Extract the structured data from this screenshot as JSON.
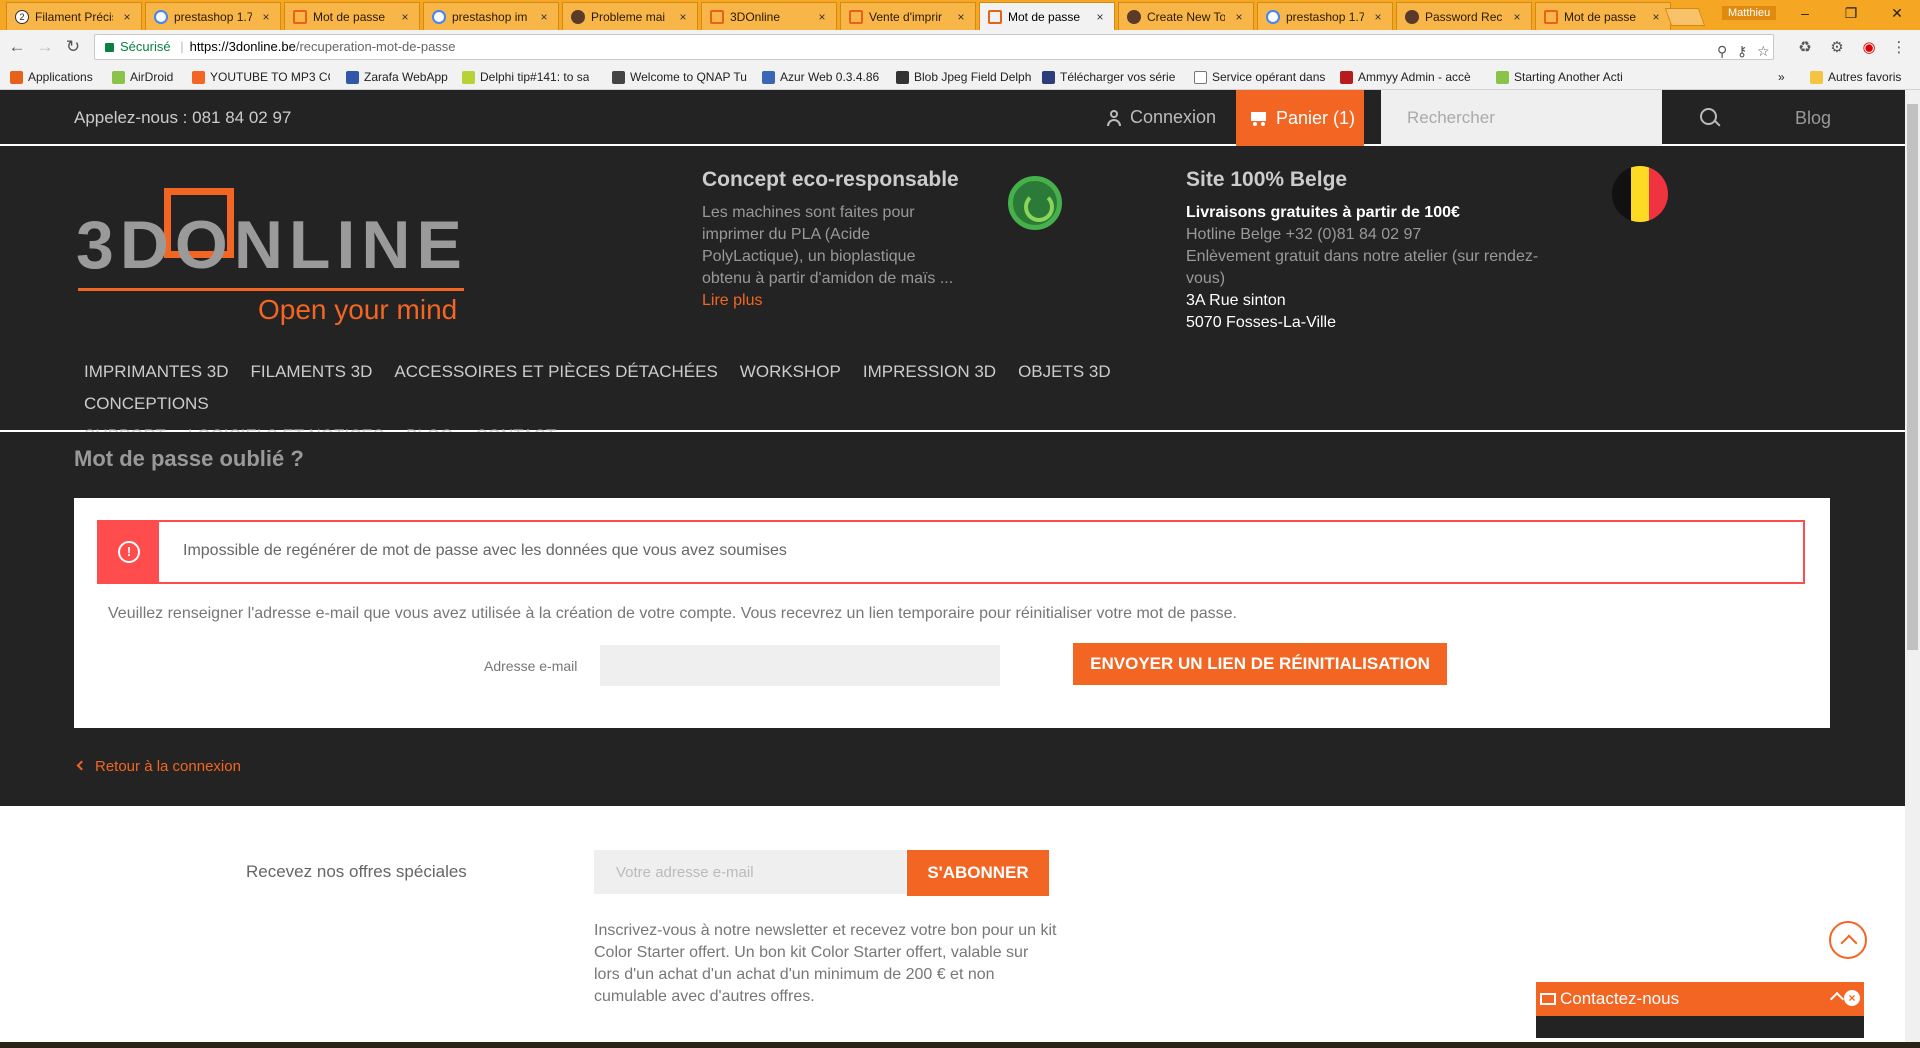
{
  "browser": {
    "tabs": [
      {
        "title": "Filament Précis",
        "icon": "num",
        "left": 0
      },
      {
        "title": "prestashop 1.7",
        "icon": "g",
        "left": 0
      },
      {
        "title": "Mot de passe",
        "icon": "orange",
        "left": 0
      },
      {
        "title": "prestashop im",
        "icon": "g",
        "left": 0
      },
      {
        "title": "Probleme mai",
        "icon": "ps",
        "left": 0
      },
      {
        "title": "3DOnline",
        "icon": "orange",
        "left": 0
      },
      {
        "title": "Vente d'imprir",
        "icon": "orange",
        "left": 0
      },
      {
        "title": "Mot de passe",
        "icon": "orange",
        "left": 0
      },
      {
        "title": "Create New To",
        "icon": "ps",
        "left": 0
      },
      {
        "title": "prestashop 1.7",
        "icon": "g",
        "left": 0
      },
      {
        "title": "Password Rec",
        "icon": "ps",
        "left": 0
      },
      {
        "title": "Mot de passe",
        "icon": "orange",
        "left": 0
      }
    ],
    "user": "Matthieu",
    "secure_label": "Sécurisé",
    "url_host": "https://3donline.be",
    "url_path": "/recuperation-mot-de-passe",
    "bookmarks": [
      "Applications",
      "AirDroid",
      "YOUTUBE TO MP3 CO",
      "Zarafa WebApp",
      "Delphi tip#141: to sa",
      "Welcome to QNAP Tu",
      "Azur Web 0.3.4.86",
      "Blob Jpeg Field Delph",
      "Télécharger vos série",
      "Service opérant dans",
      "Ammyy Admin - accè",
      "Starting Another Acti"
    ],
    "other_bookmarks": "Autres favoris"
  },
  "topbar": {
    "phone": "Appelez-nous : 081 84 02 97",
    "login": "Connexion",
    "cart": "Panier (1)",
    "search_placeholder": "Rechercher",
    "blog": "Blog"
  },
  "header": {
    "logo_text": "3DONLINE",
    "logo_tagline": "Open your mind",
    "eco": {
      "title": "Concept eco-responsable",
      "lines": [
        "Les machines sont faites pour",
        "imprimer du PLA (Acide",
        "PolyLactique), un bioplastique",
        "obtenu à partir d'amidon de maïs ..."
      ],
      "more": "Lire plus"
    },
    "belge": {
      "title": "Site 100% Belge",
      "bold": "Livraisons gratuites à partir de 100€",
      "grey": [
        "Hotline Belge +32 (0)81 84 02 97",
        "Enlèvement gratuit dans notre atelier (sur rendez-",
        "vous)"
      ],
      "white": [
        "3A Rue sinton",
        "5070 Fosses-La-Ville"
      ]
    },
    "menu": [
      "Imprimantes 3D",
      "Filaments 3D",
      "Accessoires et pièces détachées",
      "Workshop",
      "Impression 3D",
      "Objets 3D",
      "Conceptions",
      "Support",
      "Logiciels et notices",
      "Blog",
      "Contact"
    ]
  },
  "main": {
    "title": "Mot de passe oublié ?",
    "alert": "Impossible de regénérer de mot de passe avec les données que vous avez soumises",
    "help": "Veuillez renseigner l'adresse e-mail que vous avez utilisée à la création de votre compte. Vous recevrez un lien temporaire pour réinitialiser votre mot de passe.",
    "email_label": "Adresse e-mail",
    "send_button": "Envoyer un lien de réinitialisation",
    "back": "Retour à la connexion"
  },
  "newsletter": {
    "label": "Recevez nos offres spéciales",
    "placeholder": "Votre adresse e-mail",
    "button": "S'abonner",
    "desc": "Inscrivez-vous à notre newsletter et recevez votre bon pour un kit Color Starter offert. Un bon kit Color Starter offert, valable sur lors d'un achat d'un achat d'un minimum de 200 € et non cumulable avec d'autres offres."
  },
  "contact_widget": {
    "label": "Contactez-nous"
  },
  "colors": {
    "brand_orange": "#f26522",
    "dark_bg": "#232323",
    "alert_red": "#ff4c4c"
  }
}
